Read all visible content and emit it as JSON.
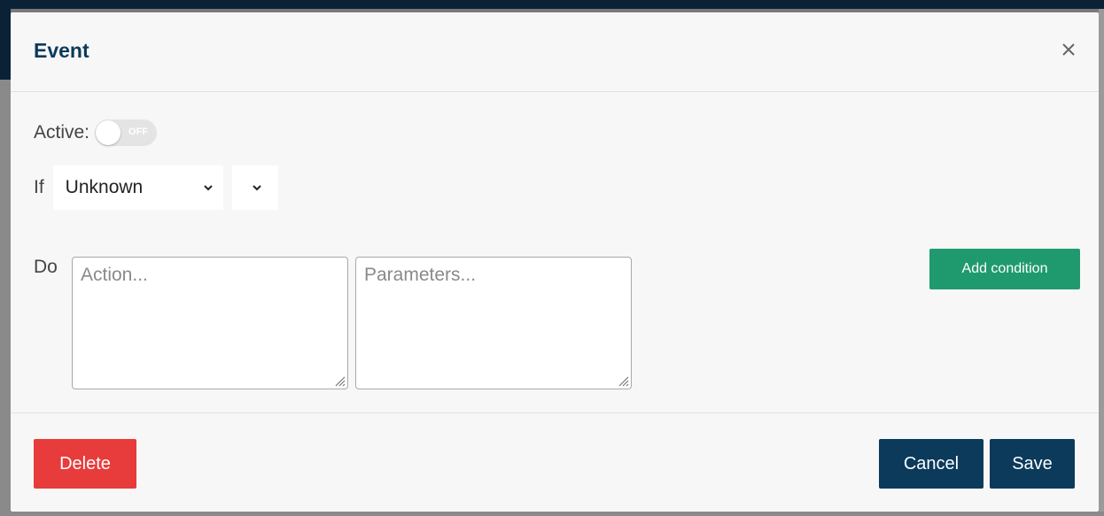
{
  "modal": {
    "title": "Event",
    "close_icon": "close-icon"
  },
  "active": {
    "label": "Active:",
    "toggle_state": "OFF"
  },
  "condition": {
    "if_label": "If",
    "selected_value": "Unknown",
    "secondary_selected_value": ""
  },
  "action": {
    "do_label": "Do",
    "action_placeholder": "Action...",
    "parameters_placeholder": "Parameters..."
  },
  "buttons": {
    "add_condition": "Add condition",
    "delete": "Delete",
    "cancel": "Cancel",
    "save": "Save"
  },
  "colors": {
    "title": "#0b3a5b",
    "primary": "#0b3a5b",
    "danger": "#e83b3b",
    "success": "#1f9a6f"
  }
}
